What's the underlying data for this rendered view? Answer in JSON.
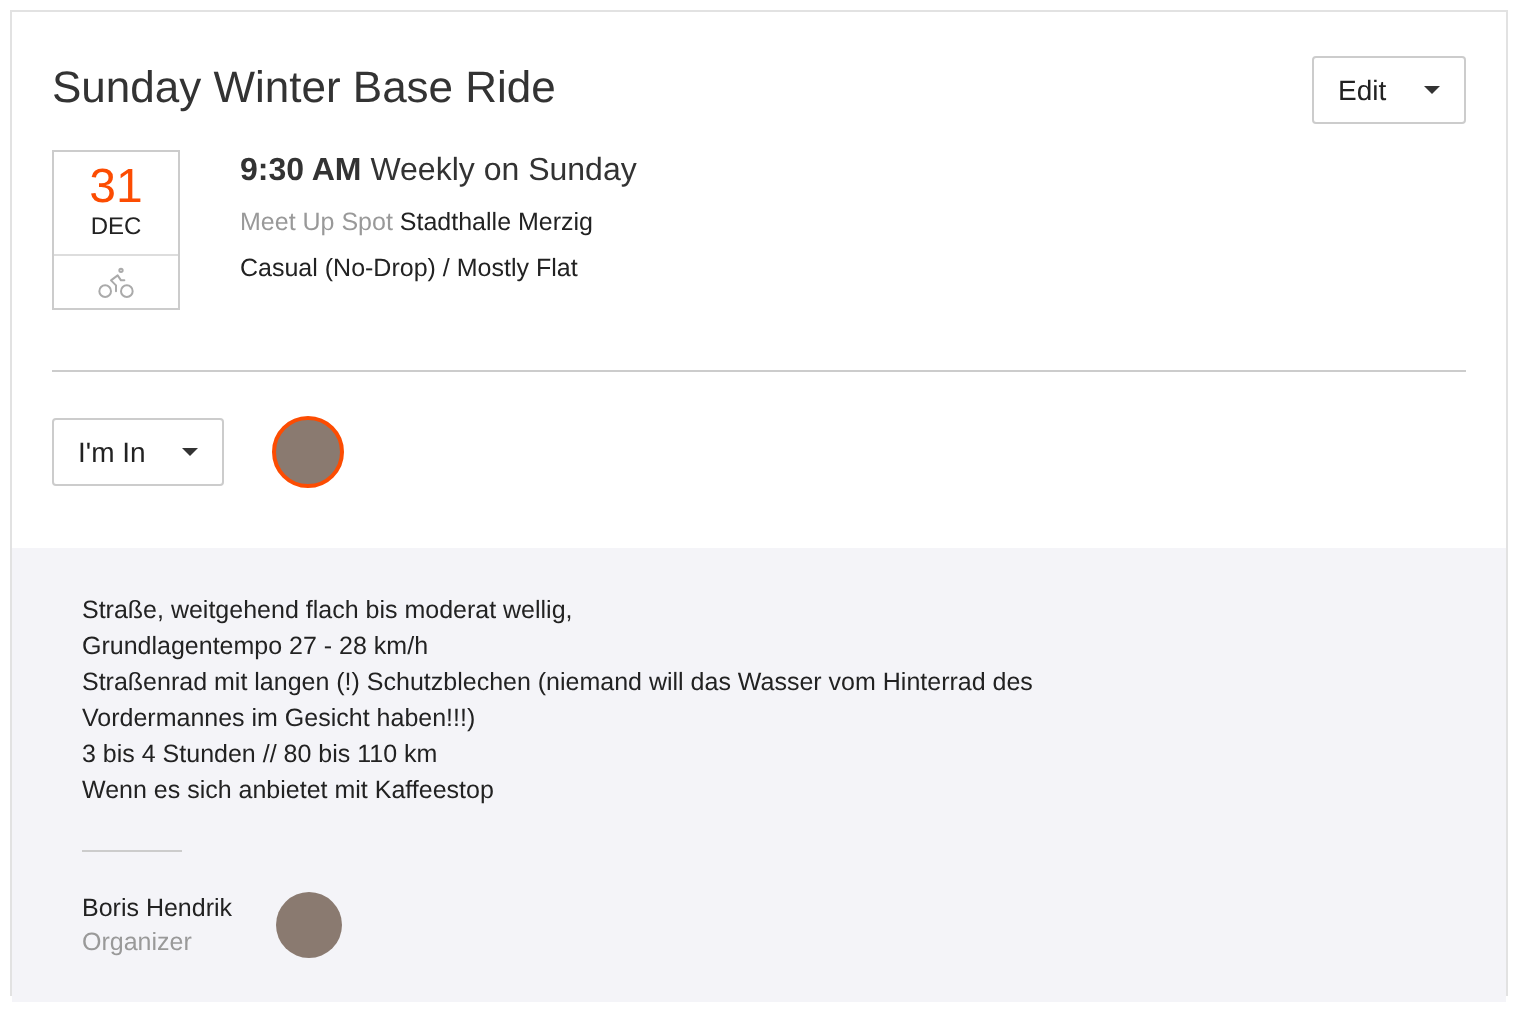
{
  "event": {
    "title": "Sunday Winter Base Ride",
    "edit_button": "Edit",
    "date": {
      "day": "31",
      "month": "DEC"
    },
    "time": "9:30 AM",
    "recurrence": "Weekly on Sunday",
    "meetup_label": "Meet Up Spot",
    "meetup_place": "Stadthalle Merzig",
    "ride_type": "Casual (No-Drop) / Mostly Flat"
  },
  "rsvp": {
    "button": "I'm In"
  },
  "description": [
    "Straße, weitgehend flach bis moderat wellig,",
    "Grundlagentempo 27 - 28 km/h",
    "Straßenrad mit langen (!) Schutzblechen (niemand will das Wasser vom Hinterrad des Vordermannes im Gesicht haben!!!)",
    "3 bis 4 Stunden // 80 bis 110 km",
    "Wenn es sich anbietet mit Kaffeestop"
  ],
  "organizer": {
    "name": "Boris Hendrik",
    "role": "Organizer"
  }
}
